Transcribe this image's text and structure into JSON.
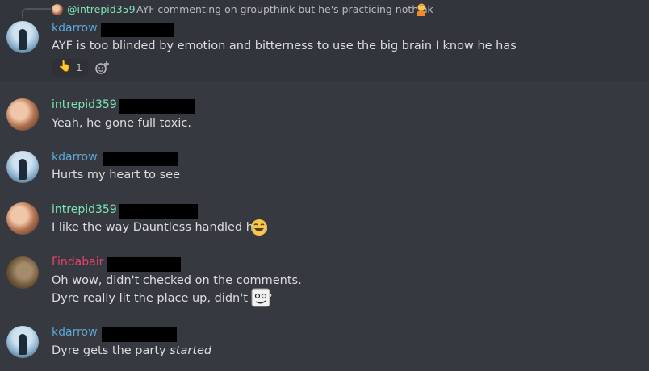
{
  "reply": {
    "mention": "@intrepid359",
    "text": "AYF commenting on groupthink but he's practicing nothink"
  },
  "messages": [
    {
      "author": "kdarrow",
      "text": "AYF is too blinded by emotion and bitterness to use the big brain I know he has"
    },
    {
      "author": "intrepid359",
      "text": "Yeah, he gone full toxic."
    },
    {
      "author": "kdarrow",
      "text": "Hurts my heart to see"
    },
    {
      "author": "intrepid359",
      "text": "I like the way Dauntless handled him"
    },
    {
      "author": "Findabair",
      "line1": "Oh wow, didn't checked on the comments.",
      "line2": "Dyre really lit the place up, didn't he?"
    },
    {
      "author": "kdarrow",
      "text_plain": "Dyre gets the party ",
      "text_italic": "started"
    }
  ],
  "reaction": {
    "emoji": "pointing-hand",
    "count": "1"
  },
  "colors": {
    "background": "#36393f",
    "kdarrow": "#5fa6d6",
    "intrepid359": "#7fe5b8",
    "Findabair": "#e8436a",
    "redaction": "#000000"
  }
}
